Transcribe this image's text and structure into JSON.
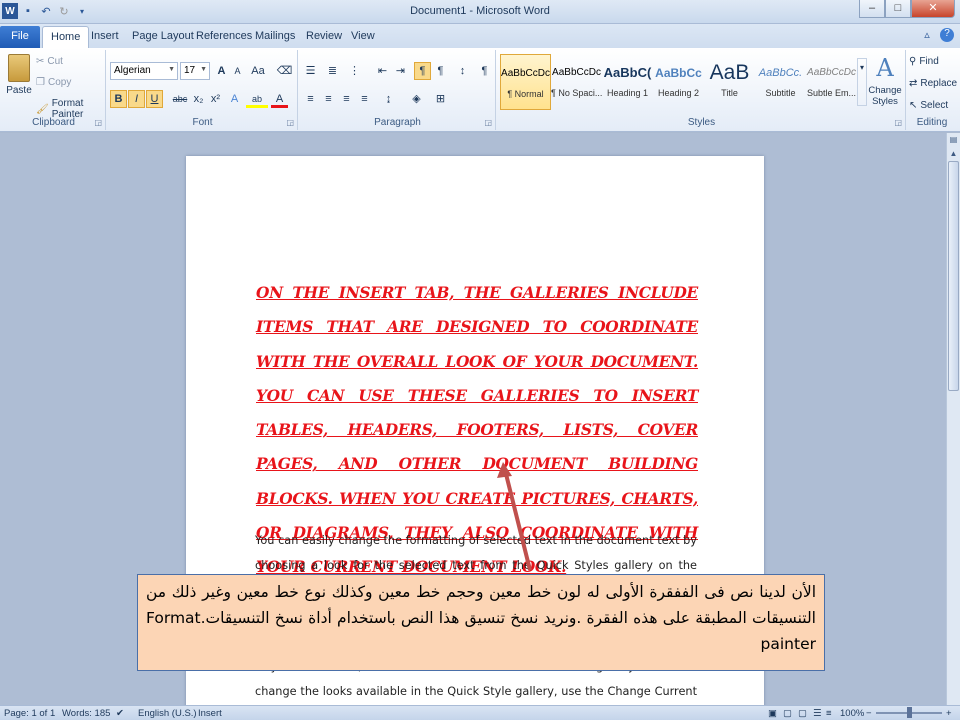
{
  "window": {
    "title": "Document1 - Microsoft Word",
    "controls": {
      "minimize": "–",
      "maximize": "□",
      "close": "✕"
    }
  },
  "quick_access": [
    "word-app-icon",
    "save-icon",
    "undo-icon",
    "redo-icon",
    "customize-icon"
  ],
  "tabs": [
    {
      "label": "File"
    },
    {
      "label": "Home"
    },
    {
      "label": "Insert"
    },
    {
      "label": "Page Layout"
    },
    {
      "label": "References"
    },
    {
      "label": "Mailings"
    },
    {
      "label": "Review"
    },
    {
      "label": "View"
    }
  ],
  "ribbon": {
    "clipboard": {
      "label": "Clipboard",
      "paste": "Paste",
      "cut": "Cut",
      "copy": "Copy",
      "format_painter": "Format Painter"
    },
    "font": {
      "label": "Font",
      "font_name": "Algerian",
      "font_size": "17",
      "grow": "A",
      "shrink": "A",
      "change_case": "Aa",
      "bold": "B",
      "italic": "I",
      "underline": "U",
      "strike": "abc",
      "subscript": "x₂",
      "superscript": "x²",
      "font_color": "A",
      "highlight": "ab"
    },
    "paragraph": {
      "label": "Paragraph"
    },
    "styles": {
      "label": "Styles",
      "items": [
        {
          "sample": "AaBbCcDc",
          "name": "¶ Normal"
        },
        {
          "sample": "AaBbCcDc",
          "name": "¶ No Spaci..."
        },
        {
          "sample": "AaBbC(",
          "name": "Heading 1"
        },
        {
          "sample": "AaBbCc",
          "name": "Heading 2"
        },
        {
          "sample": "AaB",
          "name": "Title"
        },
        {
          "sample": "AaBbCc.",
          "name": "Subtitle"
        },
        {
          "sample": "AaBbCcDc",
          "name": "Subtle Em..."
        }
      ],
      "change_styles": "Change Styles"
    },
    "editing": {
      "label": "Editing",
      "find": "Find",
      "replace": "Replace",
      "select": "Select"
    }
  },
  "document": {
    "heading_paragraph": "On the Insert tab, the galleries include items that are designed to coordinate with the overall look of your document. You can use these galleries to insert tables, headers, footers, lists, cover pages, and other document building blocks. When you create pictures, charts, or diagrams, they also coordinate with your current document look.",
    "body_paragraph": "You can easily change the formatting of selected text in the document text by choosing a look for the selected text from the Quick Styles gallery on the Home tab. You can also format text directly by using the other controls on the Home tab. Most controls offer a choice of using the look from the current theme or using a format that you specify directly. To change the overall look of your document, choose new Theme elements on the Page Layout tab. To change the looks available in the Quick Style gallery, use the Change Current Quick Style Set command. Both the Themes gallery and the Quick Styles gallery"
  },
  "callout": {
    "text_ar": "الأن لدينا نص فى الففقرة الأولى له لون خط معين وحجم خط معين وكذلك نوع خط معين وغير ذلك من التنسيقات المطبقة على هذه الفقرة .ونريد نسخ تنسيق هذا النص باستخدام أداة نسخ التنسيقات.",
    "text_en": "Format painter"
  },
  "statusbar": {
    "page": "Page: 1 of 1",
    "words": "Words: 185",
    "language": "English (U.S.)",
    "mode": "Insert",
    "zoom": "100%"
  },
  "colors": {
    "heading_text": "#e8141a",
    "callout_bg": "#fcd5b5",
    "arrow": "#c0504d"
  }
}
